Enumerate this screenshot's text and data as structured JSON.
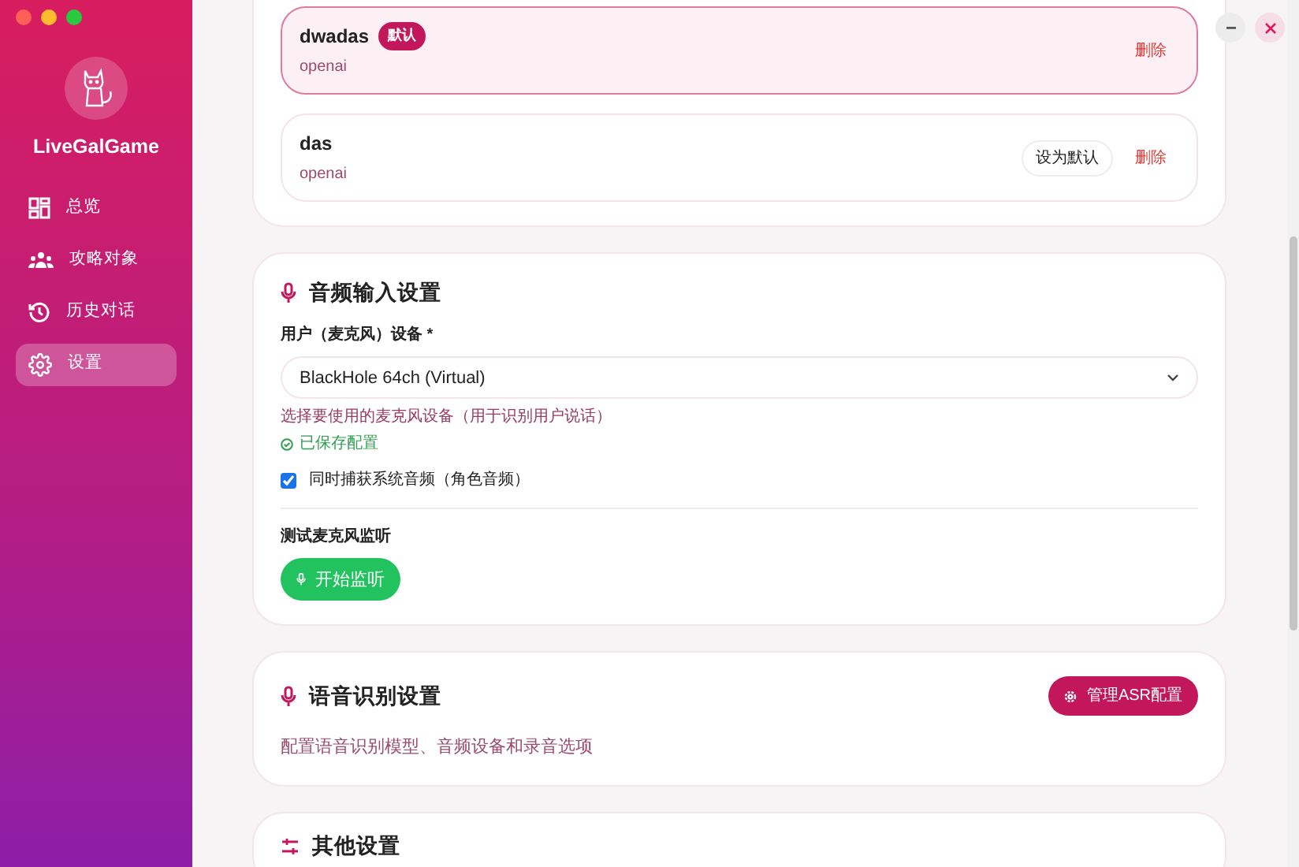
{
  "sidebar": {
    "app_name": "LiveGalGame",
    "items": [
      {
        "label": "总览",
        "kind": "grid",
        "selected": false
      },
      {
        "label": "攻略对象",
        "kind": "people",
        "selected": false
      },
      {
        "label": "历史对话",
        "kind": "history",
        "selected": false
      },
      {
        "label": "设置",
        "kind": "gear",
        "selected": true
      }
    ]
  },
  "llm_configs": [
    {
      "name": "dwadas",
      "provider": "openai",
      "selected": true,
      "badge": "默认",
      "delete": "删除"
    },
    {
      "name": "das",
      "provider": "openai",
      "selected": false,
      "set_default": "设为默认",
      "delete": "删除"
    }
  ],
  "audio_input": {
    "title": "音频输入设置",
    "device_label": "用户（麦克风）设备 *",
    "device_value": "BlackHole 64ch (Virtual)",
    "hint": "选择要使用的麦克风设备（用于识别用户说话）",
    "saved": "已保存配置",
    "capture_system": {
      "label": "同时捕获系统音频（角色音频）",
      "checked": true
    },
    "test_label": "测试麦克风监听",
    "test_button": "开始监听"
  },
  "asr": {
    "title": "语音识别设置",
    "button": "管理ASR配置",
    "description": "配置语音识别模型、音频设备和录音选项"
  },
  "other": {
    "title": "其他设置"
  }
}
